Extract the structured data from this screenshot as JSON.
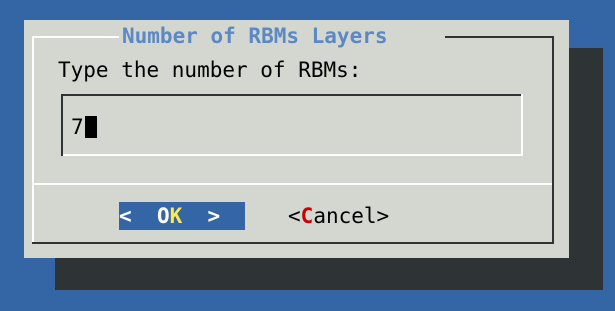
{
  "dialog": {
    "title": "Number of RBMs Layers",
    "prompt": "Type the number of RBMs:",
    "input_value": "7"
  },
  "buttons": {
    "ok": {
      "left": "<",
      "pre": "  O",
      "hotkey": "K",
      "post": "  >"
    },
    "cancel": {
      "pre": "<",
      "hotkey": "C",
      "post": "ancel>"
    }
  },
  "colors": {
    "background": "#3465a4",
    "dialog": "#d3d7cf",
    "shadow": "#2e3436",
    "title": "#5c88c5",
    "button_selected_bg": "#3465a4",
    "hotkey_selected": "#fce94f",
    "hotkey_unselected": "#cc0000"
  }
}
